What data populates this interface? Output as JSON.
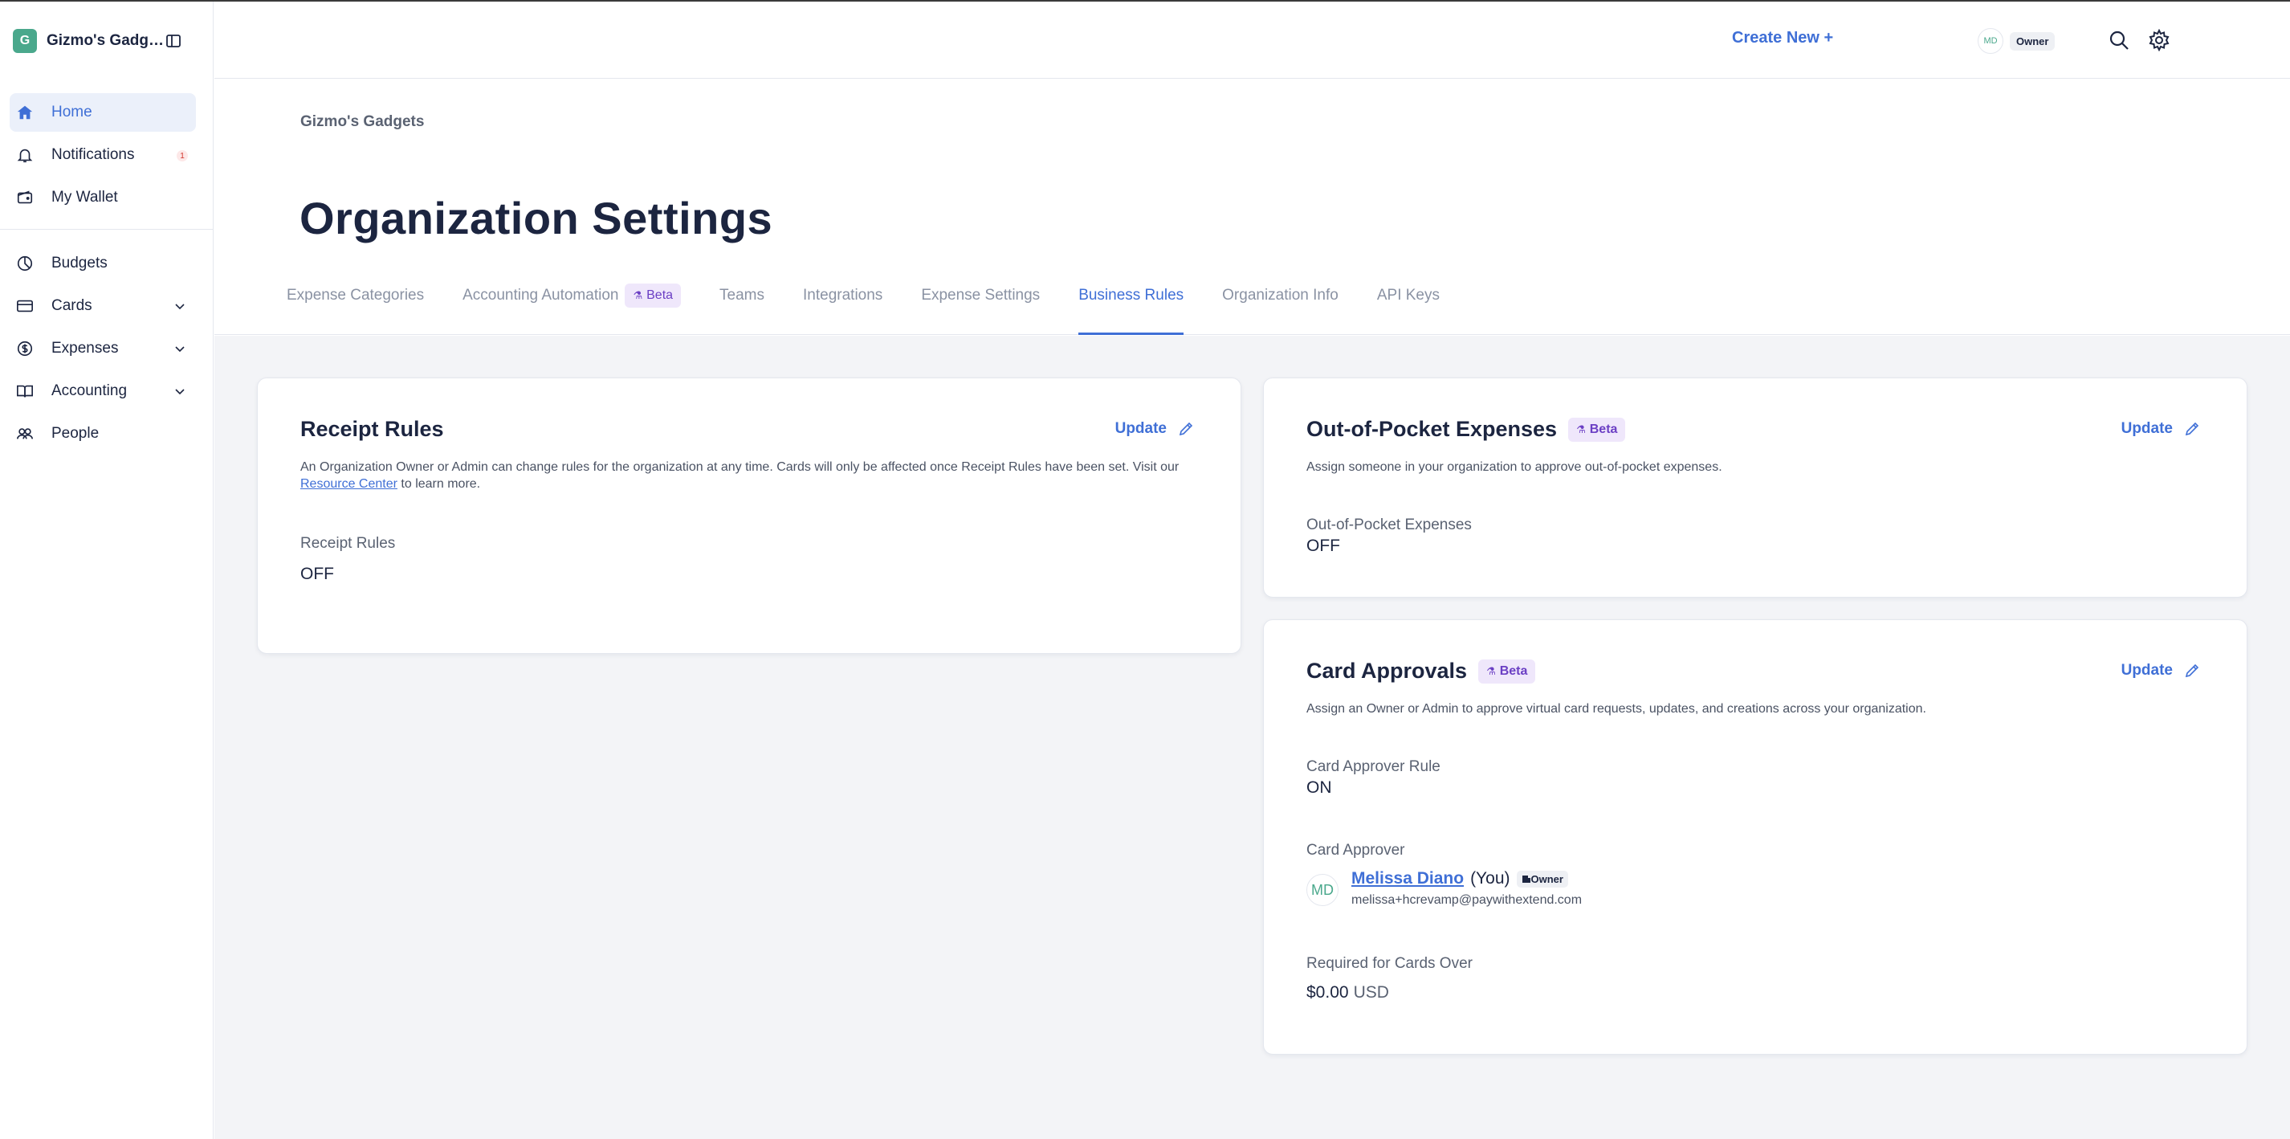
{
  "sidebar": {
    "org_initial": "G",
    "org_name": "Gizmo's Gadgets",
    "items": [
      {
        "label": "Home",
        "icon": "home-icon",
        "active": true
      },
      {
        "label": "Notifications",
        "icon": "bell-icon",
        "badge": "1"
      },
      {
        "label": "My Wallet",
        "icon": "wallet-icon"
      },
      {
        "label": "Budgets",
        "icon": "pie-chart-icon"
      },
      {
        "label": "Cards",
        "icon": "credit-card-icon",
        "expandable": true
      },
      {
        "label": "Expenses",
        "icon": "dollar-circle-icon",
        "expandable": true
      },
      {
        "label": "Accounting",
        "icon": "book-icon",
        "expandable": true
      },
      {
        "label": "People",
        "icon": "people-icon"
      }
    ]
  },
  "topbar": {
    "create_new": "Create New +",
    "user_initials": "MD",
    "user_role": "Owner"
  },
  "header": {
    "breadcrumb": "Gizmo's Gadgets",
    "title": "Organization Settings",
    "tabs": [
      {
        "label": "Expense Categories"
      },
      {
        "label": "Accounting Automation",
        "badge": "Beta"
      },
      {
        "label": "Teams"
      },
      {
        "label": "Integrations"
      },
      {
        "label": "Expense Settings"
      },
      {
        "label": "Business Rules",
        "active": true
      },
      {
        "label": "Organization Info"
      },
      {
        "label": "API Keys"
      }
    ]
  },
  "receipt_rules": {
    "title": "Receipt Rules",
    "update": "Update",
    "desc_before": "An Organization Owner or Admin can change rules for the organization at any time. Cards will only be affected once Receipt Rules have been set. Visit our ",
    "desc_link": "Resource Center",
    "desc_after": " to learn more.",
    "field_label": "Receipt Rules",
    "field_value": "OFF"
  },
  "oop": {
    "title": "Out-of-Pocket Expenses",
    "badge": "Beta",
    "update": "Update",
    "desc": "Assign someone in your organization to approve out-of-pocket expenses.",
    "field_label": "Out-of-Pocket Expenses",
    "field_value": "OFF"
  },
  "card_approvals": {
    "title": "Card Approvals",
    "badge": "Beta",
    "update": "Update",
    "desc": "Assign an Owner or Admin to approve virtual card requests, updates, and creations across your organization.",
    "rule_label": "Card Approver Rule",
    "rule_value": "ON",
    "approver_label": "Card Approver",
    "approver_initials": "MD",
    "approver_name": "Melissa Diano",
    "approver_you": "(You)",
    "approver_role": "Owner",
    "approver_email": "melissa+hcrevamp@paywithextend.com",
    "required_label": "Required for Cards Over",
    "required_amount": "$0.00",
    "required_currency": "USD"
  },
  "colors": {
    "accent": "#3f6fd6",
    "org_avatar": "#4aa88c",
    "beta_bg": "#efe7fb",
    "beta_fg": "#6b3fc4",
    "page_bg": "#f3f4f7"
  }
}
